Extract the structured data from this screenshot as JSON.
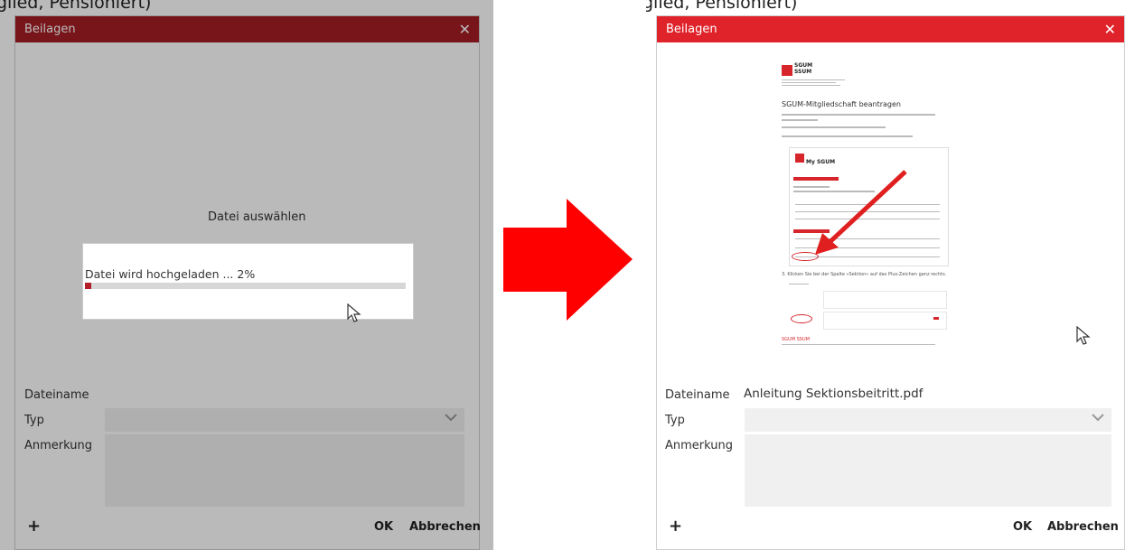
{
  "background_text": "glied, Pensioniert)",
  "dialog": {
    "title": "Beilagen",
    "close_icon": "close-icon",
    "labels": {
      "filename": "Dateiname",
      "type": "Typ",
      "note": "Anmerkung"
    },
    "buttons": {
      "add": "+",
      "ok": "OK",
      "cancel": "Abbrechen"
    }
  },
  "before": {
    "header_color": "#a51d24",
    "select_file_label": "Datei auswählen",
    "upload_status": "Datei wird hochgeladen ... 2%",
    "upload_progress": 0.02,
    "filename_value": ""
  },
  "after": {
    "header_color": "#e0232a",
    "filename_value": "Anleitung Sektionsbeitritt.pdf",
    "preview": {
      "logo_text": "SGUM\nSSUM",
      "title": "SGUM-Mitgliedschaft beantragen",
      "app_name": "My SGUM",
      "step3_text": "3. Klicken Sie bei der Spalte «Sektion» auf das Plus-Zeichen ganz rechts.",
      "footer": "SGUM SSUM"
    }
  },
  "transition_arrow": {
    "color": "#ff0000",
    "icon": "arrow-right-icon"
  },
  "cursor_icon": "mouse-pointer-icon"
}
